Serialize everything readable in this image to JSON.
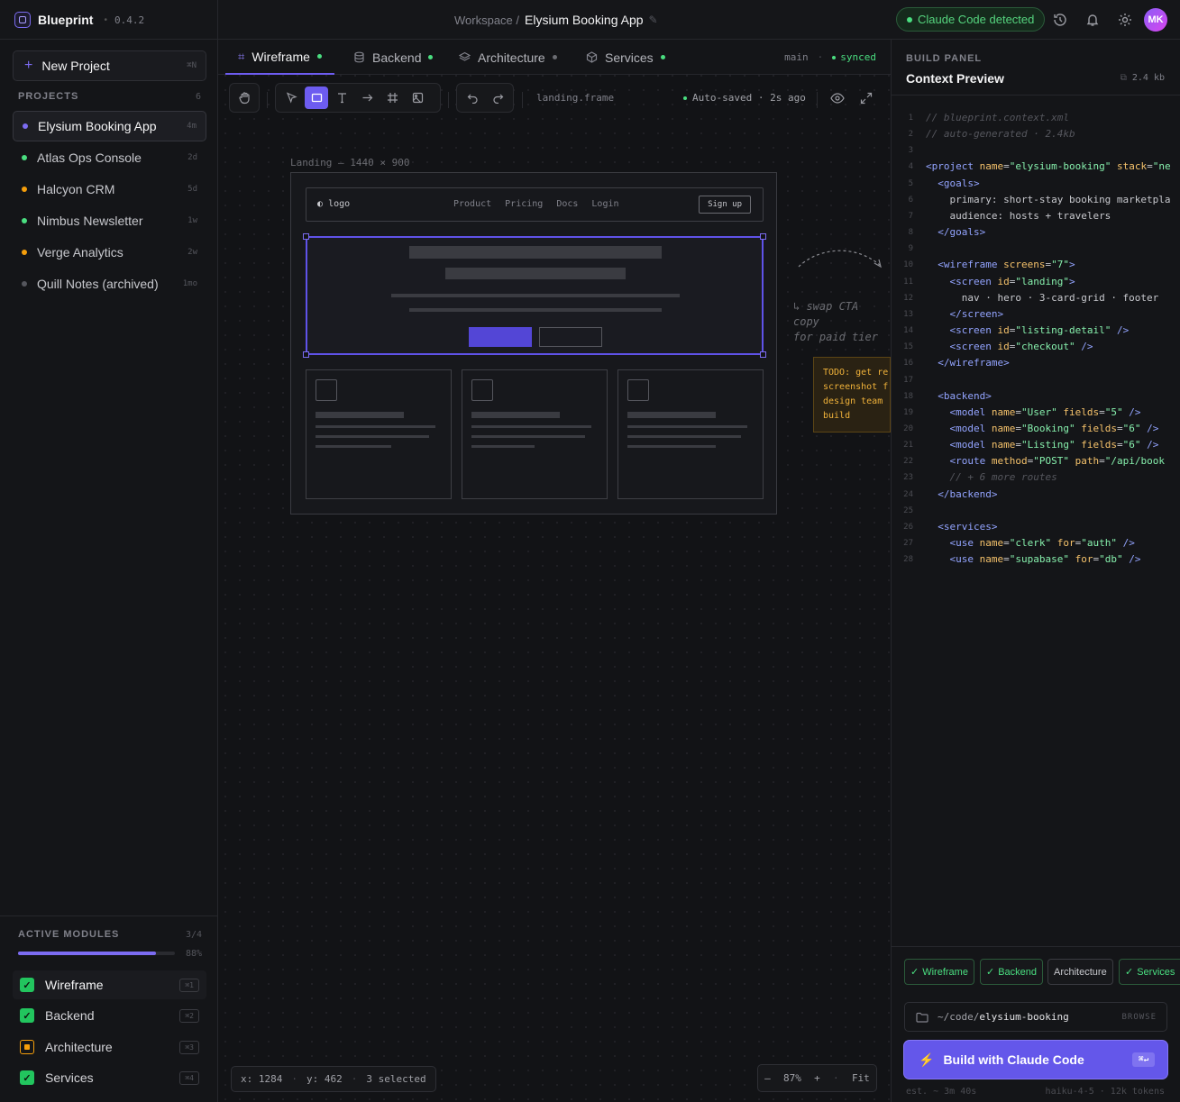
{
  "app": {
    "name": "Blueprint",
    "version": "0.4.2"
  },
  "breadcrumb": {
    "workspace": "Workspace /",
    "current": "Elysium Booking App"
  },
  "status": {
    "claude": "Claude Code detected"
  },
  "user": {
    "initials": "MK"
  },
  "sidebar": {
    "new_project": "New Project",
    "new_project_kbd": "⌘N",
    "projects_header": "PROJECTS",
    "projects_count": "6",
    "projects": [
      {
        "name": "Elysium Booking App",
        "age": "4m",
        "color": "#7c6cf2"
      },
      {
        "name": "Atlas Ops Console",
        "age": "2d",
        "color": "#4ade80"
      },
      {
        "name": "Halcyon CRM",
        "age": "5d",
        "color": "#f59e0b"
      },
      {
        "name": "Nimbus Newsletter",
        "age": "1w",
        "color": "#4ade80"
      },
      {
        "name": "Verge Analytics",
        "age": "2w",
        "color": "#f59e0b"
      },
      {
        "name": "Quill Notes (archived)",
        "age": "1mo",
        "color": "#55565d"
      }
    ],
    "modules_header": "ACTIVE MODULES",
    "modules_count": "3/4",
    "modules_progress": "88%",
    "modules_progress_value": 0.88,
    "modules": [
      {
        "name": "Wireframe",
        "kbd": "⌘1"
      },
      {
        "name": "Backend",
        "kbd": "⌘2"
      },
      {
        "name": "Architecture",
        "kbd": "⌘3"
      },
      {
        "name": "Services",
        "kbd": "⌘4"
      }
    ]
  },
  "tabs": [
    {
      "label": "Wireframe"
    },
    {
      "label": "Backend"
    },
    {
      "label": "Architecture"
    },
    {
      "label": "Services"
    }
  ],
  "branch": {
    "name": "main",
    "sep": "·",
    "state": "synced"
  },
  "toolbar": {
    "frame": "landing.frame",
    "autosave": "Auto-saved · 2s ago"
  },
  "canvas": {
    "frame_label": "Landing — 1440 × 900",
    "logo": "logo",
    "links": [
      "Product",
      "Pricing",
      "Docs",
      "Login"
    ],
    "signup": "Sign up",
    "annotation": [
      "↳ swap CTA",
      "copy",
      "for paid tier"
    ],
    "sticky": [
      "TODO: get re",
      "screenshot f",
      "design team",
      "build"
    ],
    "coords": {
      "x": "x: 1284",
      "y": "y: 462",
      "sel": "3 selected"
    },
    "zoom": {
      "minus": "—",
      "value": "87%",
      "plus": "+",
      "fit": "Fit"
    }
  },
  "panel": {
    "kicker": "BUILD PANEL",
    "title": "Context Preview",
    "size": "2.4 kb",
    "chips": [
      "Wireframe",
      "Backend",
      "Architecture",
      "Services"
    ],
    "path_prefix": "~/code/",
    "path_name": "elysium-booking",
    "browse": "BROWSE",
    "build": "Build with Claude Code",
    "build_kbd": "⌘↵",
    "est": "est. ~ 3m 40s",
    "model": "haiku-4-5 · 12k tokens"
  }
}
